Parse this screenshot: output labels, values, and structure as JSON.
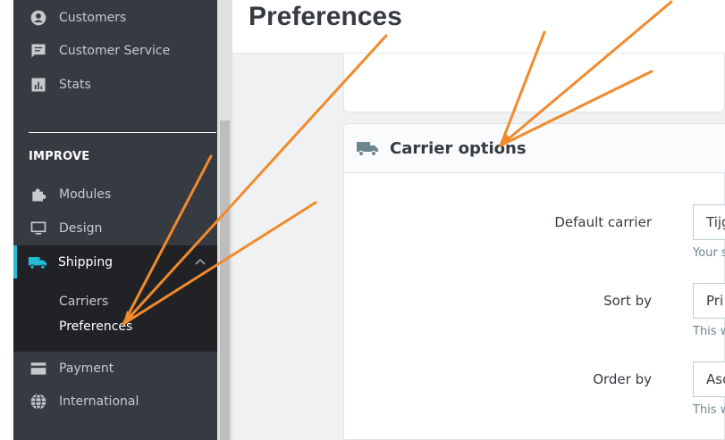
{
  "sidebar": {
    "items_top": [
      {
        "label": "Customers",
        "icon": "account-circle-icon"
      },
      {
        "label": "Customer Service",
        "icon": "chat-icon"
      },
      {
        "label": "Stats",
        "icon": "bar-chart-icon"
      }
    ],
    "section_label": "IMPROVE",
    "items_improve": [
      {
        "label": "Modules",
        "icon": "puzzle-icon"
      },
      {
        "label": "Design",
        "icon": "monitor-icon"
      },
      {
        "label": "Shipping",
        "icon": "truck-icon"
      }
    ],
    "submenu": [
      {
        "label": "Carriers"
      },
      {
        "label": "Preferences"
      }
    ],
    "items_bottom": [
      {
        "label": "Payment",
        "icon": "credit-card-icon"
      },
      {
        "label": "International",
        "icon": "globe-icon"
      }
    ]
  },
  "header": {
    "title": "Preferences"
  },
  "card": {
    "title": "Carrier options",
    "icon": "truck-icon",
    "fields": [
      {
        "label": "Default carrier",
        "value": "Tijg",
        "help": "Your s"
      },
      {
        "label": "Sort by",
        "value": "Pri",
        "help": "This w"
      },
      {
        "label": "Order by",
        "value": "Asc",
        "help": "This w"
      }
    ]
  },
  "colors": {
    "sidebar_bg": "#363a41",
    "sidebar_active_bg": "#202226",
    "accent": "#25b9d7",
    "annotation": "#f08a2c"
  }
}
